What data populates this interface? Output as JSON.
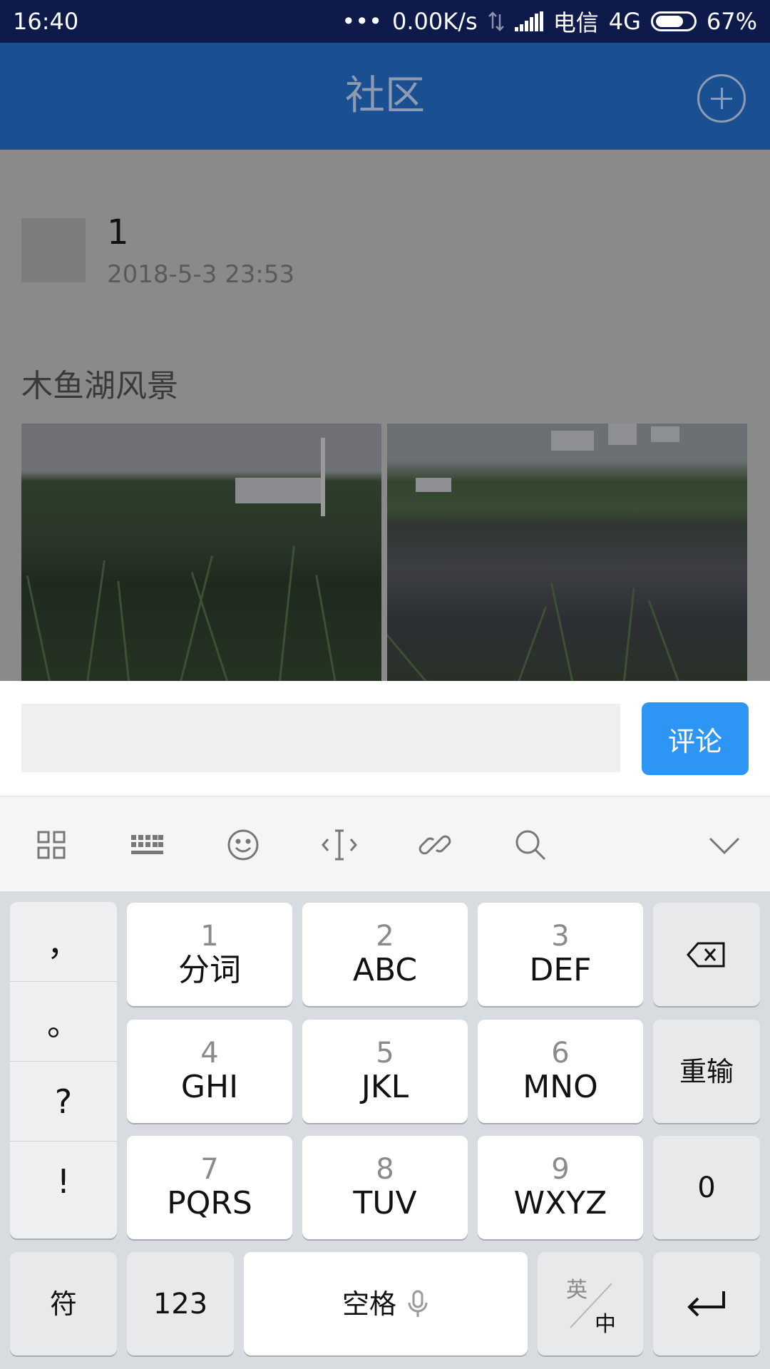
{
  "status_bar": {
    "time": "16:40",
    "dots": "•••",
    "speed": "0.00K/s",
    "carrier": "电信",
    "network": "4G",
    "battery": "67%"
  },
  "header": {
    "title": "社区"
  },
  "post": {
    "username": "1",
    "timestamp": "2018-5-3 23:53",
    "text": "木鱼湖风景"
  },
  "comment": {
    "input_value": "",
    "button_label": "评论"
  },
  "keyboard": {
    "punctuation": [
      "，",
      "。",
      "?",
      "!"
    ],
    "keys": [
      {
        "num": "1",
        "letters": "分词"
      },
      {
        "num": "2",
        "letters": "ABC"
      },
      {
        "num": "3",
        "letters": "DEF"
      },
      {
        "num": "4",
        "letters": "GHI"
      },
      {
        "num": "5",
        "letters": "JKL"
      },
      {
        "num": "6",
        "letters": "MNO"
      },
      {
        "num": "7",
        "letters": "PQRS"
      },
      {
        "num": "8",
        "letters": "TUV"
      },
      {
        "num": "9",
        "letters": "WXYZ"
      }
    ],
    "retype": "重输",
    "zero": "0",
    "symbols": "符",
    "numbers": "123",
    "space": "空格",
    "lang_en": "英",
    "lang_zh": "中"
  },
  "colors": {
    "status_bar": "#0d1a4a",
    "app_bar": "#1a4f92",
    "comment_button": "#2d96f5"
  }
}
